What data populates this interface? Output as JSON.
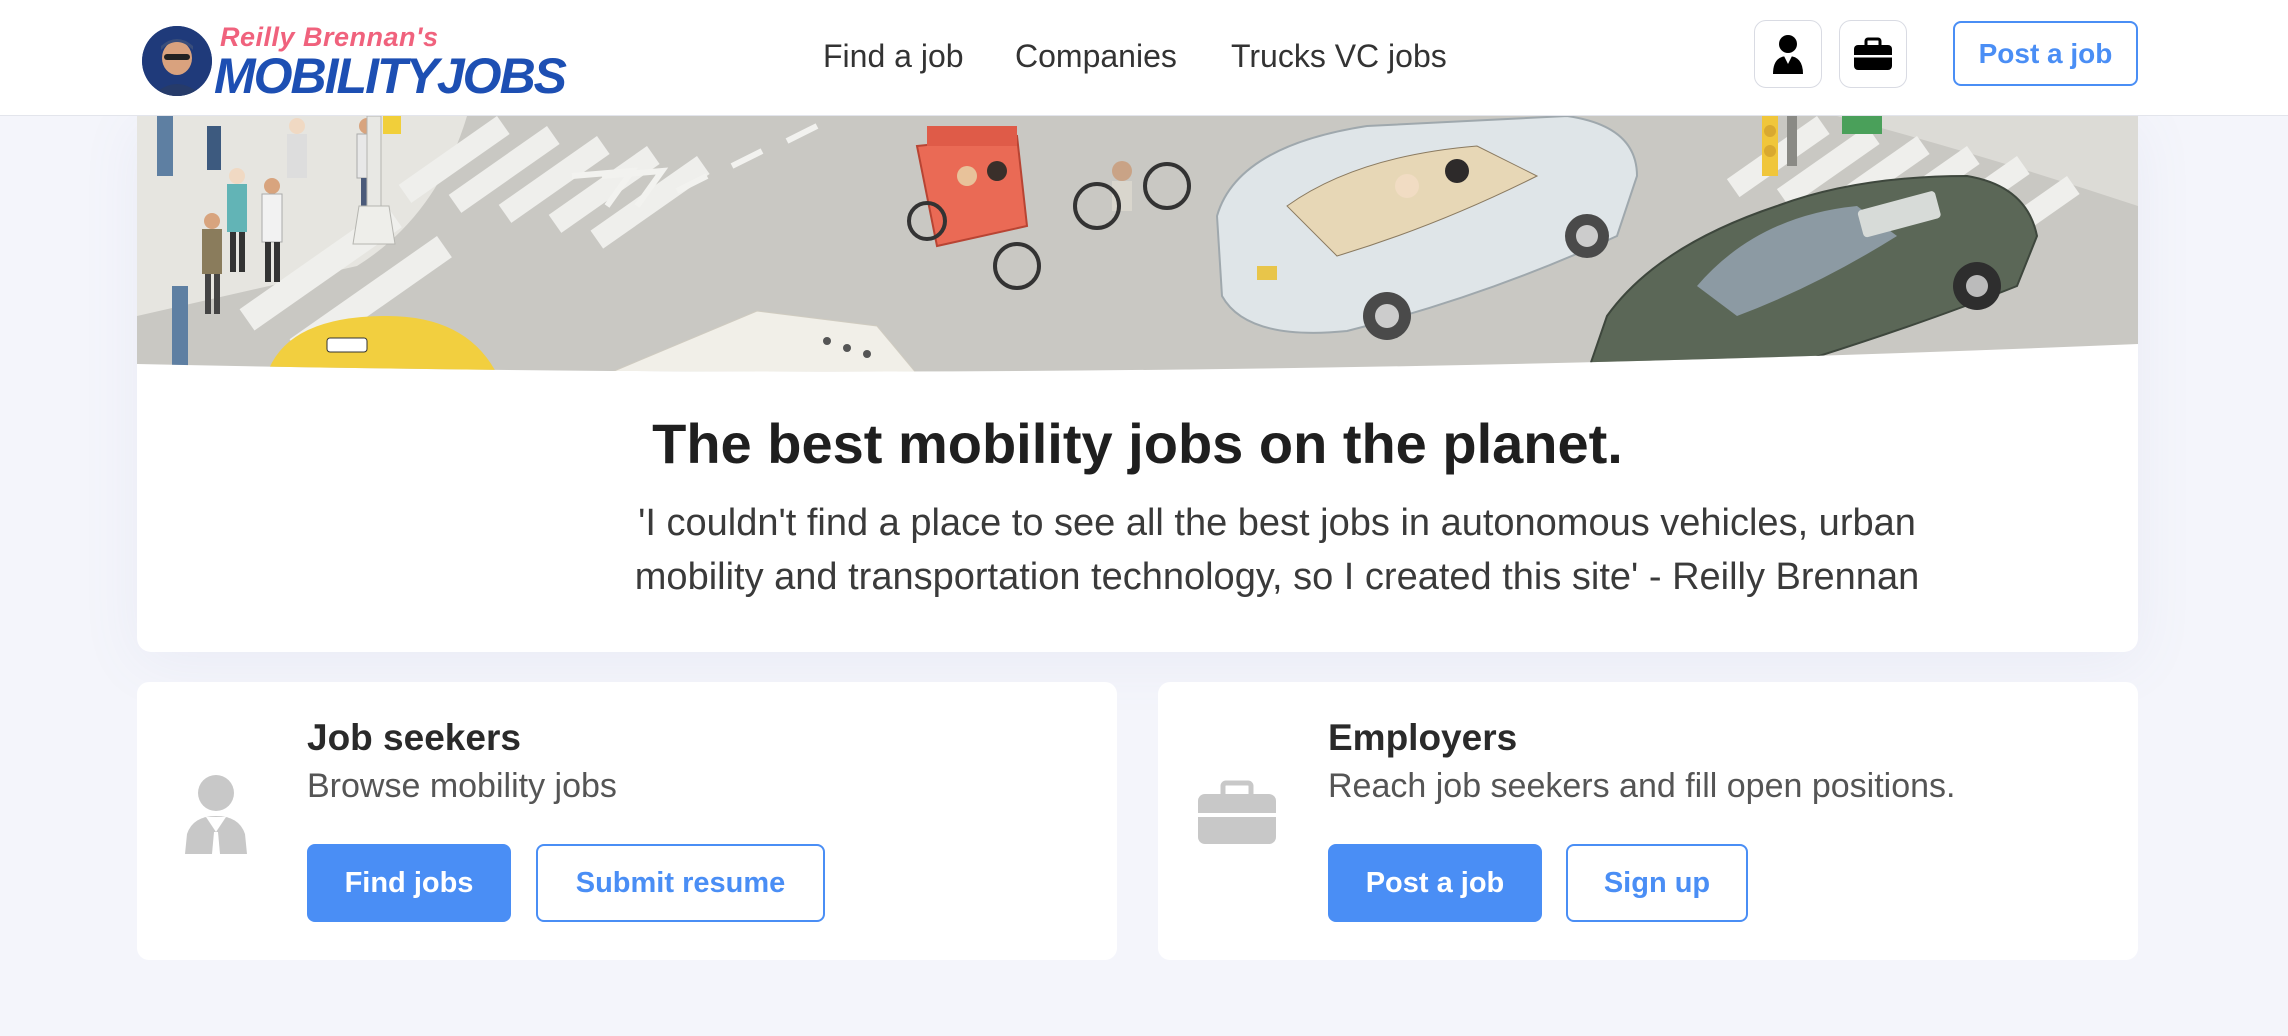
{
  "header": {
    "logo_small": "Reilly Brennan's",
    "logo_big": "MOBILITYJOBS",
    "nav": [
      {
        "label": "Find a job"
      },
      {
        "label": "Companies"
      },
      {
        "label": "Trucks VC jobs"
      }
    ],
    "post_job_label": "Post a job",
    "icons": [
      "person-icon",
      "briefcase-icon"
    ]
  },
  "hero": {
    "title": "The best mobility jobs on the planet.",
    "quote": "'I couldn't find a place to see all the best jobs in autonomous vehicles, urban mobility and transportation technology, so I created this site' - Reilly Brennan"
  },
  "cards": {
    "seekers": {
      "title": "Job seekers",
      "subtitle": "Browse mobility jobs",
      "primary": "Find jobs",
      "secondary": "Submit resume",
      "icon": "person-icon"
    },
    "employers": {
      "title": "Employers",
      "subtitle": "Reach job seekers and fill open positions.",
      "primary": "Post a job",
      "secondary": "Sign up",
      "icon": "briefcase-icon"
    }
  },
  "colors": {
    "accent": "#4a8ef5",
    "logo_pink": "#f0627d",
    "logo_blue": "#1d4fb3",
    "page_bg": "#f4f5fb"
  }
}
